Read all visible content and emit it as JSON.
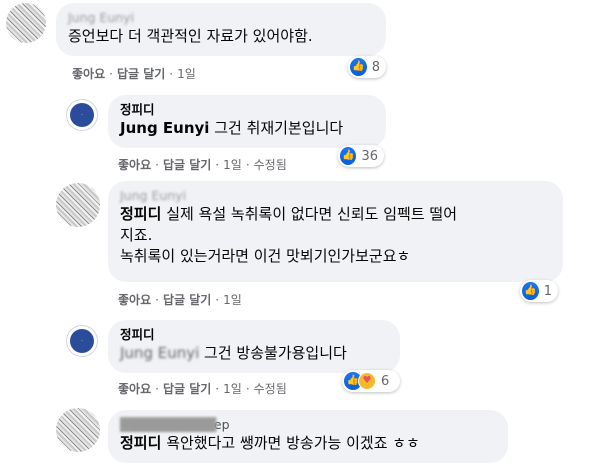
{
  "comments": [
    {
      "author": "Jung Eunyi",
      "text": "증언보다 더 객관적인 자료가 있어야함.",
      "actions": {
        "like": "좋아요",
        "reply": "답글 달기",
        "time": "1일"
      },
      "reaction_count": "8"
    },
    {
      "author": "정피디",
      "mention": "Jung Eunyi",
      "text": "그건 취재기본입니다",
      "actions": {
        "like": "좋아요",
        "reply": "답글 달기",
        "time": "1일",
        "edited": "수정됨"
      },
      "reaction_count": "36"
    },
    {
      "author": "Jung Eunyi",
      "mention": "정피디",
      "text_line1": "실제 욕설 녹취록이 없다면 신뢰도 임펙트 떨어",
      "text_line2": "지죠.",
      "text_line3": "녹취록이 있는거라면 이건 맛뵈기인가보군요ㅎ",
      "actions": {
        "like": "좋아요",
        "reply": "답글 달기",
        "time": "1일"
      },
      "reaction_count": "1"
    },
    {
      "author": "정피디",
      "mention": "Jung Eunyi",
      "text": "그건 방송불가용입니다",
      "actions": {
        "like": "좋아요",
        "reply": "답글 달기",
        "time": "1일",
        "edited": "수정됨"
      },
      "reaction_count": "6"
    },
    {
      "author": "Sep",
      "mention": "정피디",
      "text": "욕안했다고 쌩까면 방송가능 이겠죠 ㅎㅎ"
    }
  ],
  "separator": "·",
  "icons": {
    "like": "thumbs-up-icon",
    "care": "care-icon"
  },
  "colors": {
    "like_blue": "#1877f2",
    "bubble_bg": "#f0f2f5",
    "meta_gray": "#65676b"
  }
}
